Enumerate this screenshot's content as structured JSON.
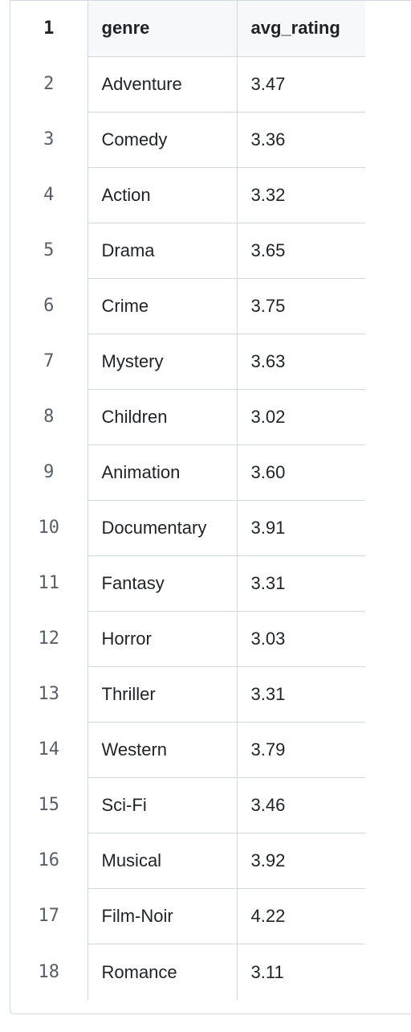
{
  "table": {
    "columns": [
      "genre",
      "avg_rating"
    ],
    "header_line": "1",
    "rows": [
      {
        "line": "2",
        "genre": "Adventure",
        "avg_rating": "3.47"
      },
      {
        "line": "3",
        "genre": "Comedy",
        "avg_rating": "3.36"
      },
      {
        "line": "4",
        "genre": "Action",
        "avg_rating": "3.32"
      },
      {
        "line": "5",
        "genre": "Drama",
        "avg_rating": "3.65"
      },
      {
        "line": "6",
        "genre": "Crime",
        "avg_rating": "3.75"
      },
      {
        "line": "7",
        "genre": "Mystery",
        "avg_rating": "3.63"
      },
      {
        "line": "8",
        "genre": "Children",
        "avg_rating": "3.02"
      },
      {
        "line": "9",
        "genre": "Animation",
        "avg_rating": "3.60"
      },
      {
        "line": "10",
        "genre": "Documentary",
        "avg_rating": "3.91"
      },
      {
        "line": "11",
        "genre": "Fantasy",
        "avg_rating": "3.31"
      },
      {
        "line": "12",
        "genre": "Horror",
        "avg_rating": "3.03"
      },
      {
        "line": "13",
        "genre": "Thriller",
        "avg_rating": "3.31"
      },
      {
        "line": "14",
        "genre": "Western",
        "avg_rating": "3.79"
      },
      {
        "line": "15",
        "genre": "Sci-Fi",
        "avg_rating": "3.46"
      },
      {
        "line": "16",
        "genre": "Musical",
        "avg_rating": "3.92"
      },
      {
        "line": "17",
        "genre": "Film-Noir",
        "avg_rating": "4.22"
      },
      {
        "line": "18",
        "genre": "Romance",
        "avg_rating": "3.11"
      }
    ]
  },
  "colors": {
    "border": "#d0d7de",
    "header_bg": "#f6f8fa",
    "text": "#1f2328",
    "line_number": "#57606a"
  }
}
